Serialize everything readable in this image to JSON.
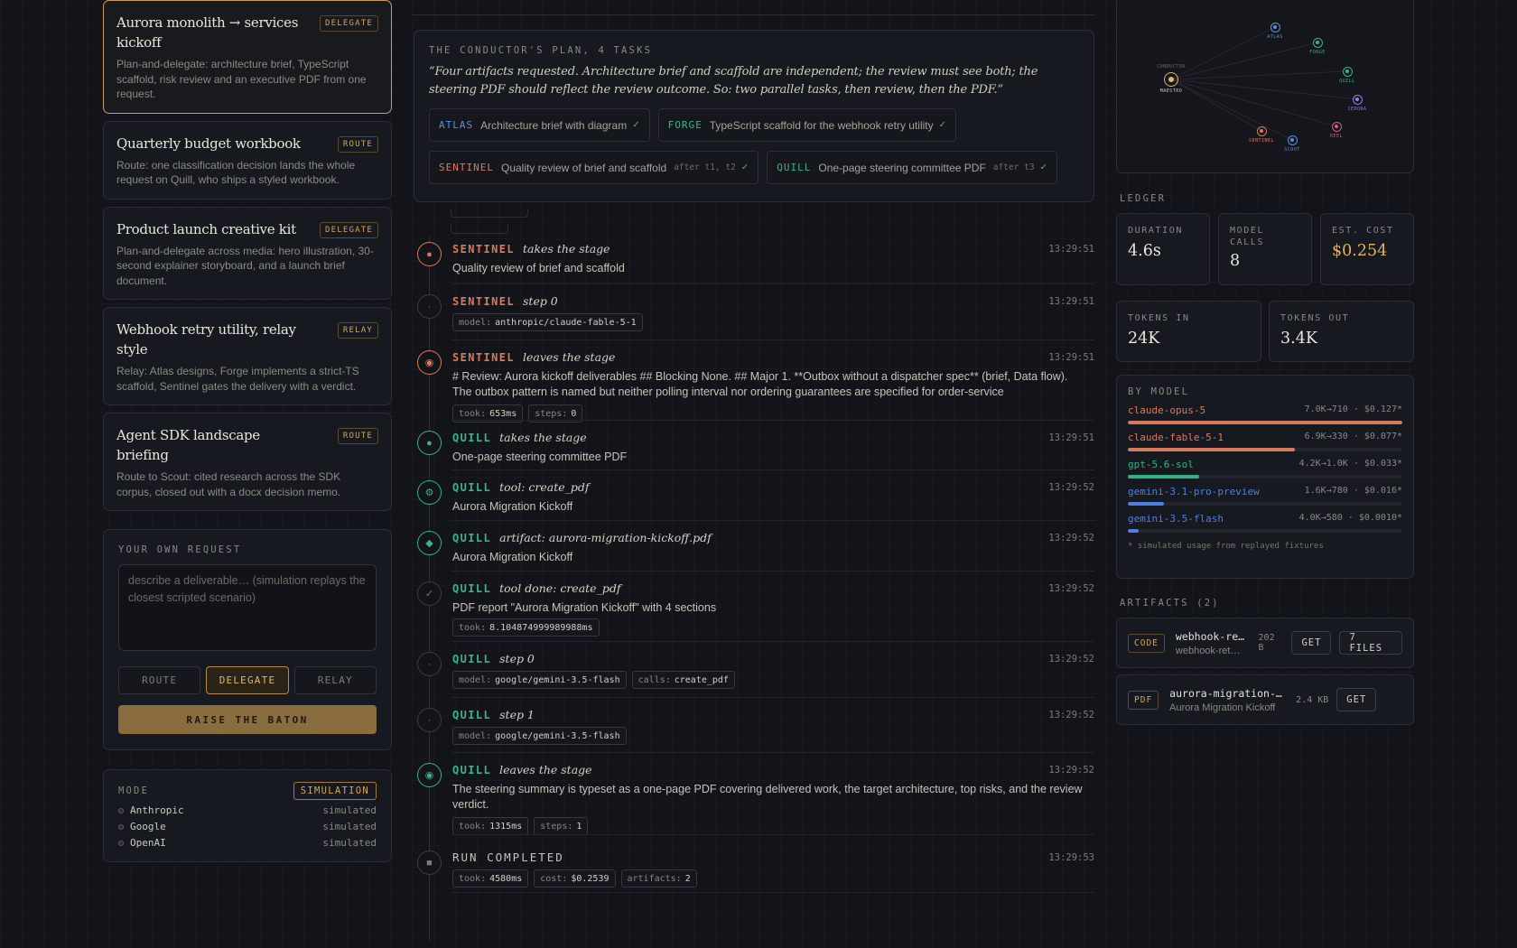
{
  "scenarios": [
    {
      "title": "Aurora monolith → services kickoff",
      "badge": "DELEGATE",
      "desc": "Plan-and-delegate: architecture brief, TypeScript scaffold, risk review and an executive PDF from one request."
    },
    {
      "title": "Quarterly budget workbook",
      "badge": "ROUTE",
      "desc": "Route: one classification decision lands the whole request on Quill, who ships a styled workbook."
    },
    {
      "title": "Product launch creative kit",
      "badge": "DELEGATE",
      "desc": "Plan-and-delegate across media: hero illustration, 30-second explainer storyboard, and a launch brief document."
    },
    {
      "title": "Webhook retry utility, relay style",
      "badge": "RELAY",
      "desc": "Relay: Atlas designs, Forge implements a strict-TS scaffold, Sentinel gates the delivery with a verdict."
    },
    {
      "title": "Agent SDK landscape briefing",
      "badge": "ROUTE",
      "desc": "Route to Scout: cited research across the SDK corpus, closed out with a docx decision memo."
    }
  ],
  "request": {
    "label": "YOUR OWN REQUEST",
    "placeholder": "describe a deliverable… (simulation replays the closest scripted scenario)",
    "modes": [
      "ROUTE",
      "DELEGATE",
      "RELAY"
    ],
    "selected_mode": "DELEGATE",
    "submit": "RAISE THE BATON"
  },
  "mode_panel": {
    "label": "MODE",
    "badge": "SIMULATION",
    "providers": [
      {
        "name": "Anthropic",
        "status": "simulated"
      },
      {
        "name": "Google",
        "status": "simulated"
      },
      {
        "name": "OpenAI",
        "status": "simulated"
      }
    ]
  },
  "plan": {
    "label": "THE CONDUCTOR'S PLAN, 4 TASKS",
    "quote": "“Four artifacts requested. Architecture brief and scaffold are independent; the review must see both; the steering PDF should reflect the review outcome. So: two parallel tasks, then review, then the PDF.”",
    "tasks": [
      {
        "agent": "ATLAS",
        "color": "#5a8fe0",
        "text": "Architecture brief with diagram",
        "after": "",
        "check": "✓"
      },
      {
        "agent": "FORGE",
        "color": "#39b38c",
        "text": "TypeScript scaffold for the webhook retry utility",
        "after": "",
        "check": "✓"
      },
      {
        "agent": "SENTINEL",
        "color": "#d77b5b",
        "text": "Quality review of brief and scaffold",
        "after": "after t1, t2",
        "check": "✓"
      },
      {
        "agent": "QUILL",
        "color": "#39b38c",
        "text": "One-page steering committee PDF",
        "after": "after t3",
        "check": "✓"
      }
    ]
  },
  "events": [
    {
      "agent": "SENTINEL",
      "action": "takes the stage",
      "time": "13:29:51",
      "body": "Quality review of brief and scaffold",
      "tags": [],
      "icon": "●"
    },
    {
      "agent": "SENTINEL",
      "action": "step 0",
      "time": "13:29:51",
      "body": "",
      "tags": [
        {
          "k": "model:",
          "v": "anthropic/claude-fable-5-1"
        }
      ],
      "icon": "·"
    },
    {
      "agent": "SENTINEL",
      "action": "leaves the stage",
      "time": "13:29:51",
      "body": "# Review: Aurora kickoff deliverables ## Blocking None. ## Major 1. **Outbox without a dispatcher spec** (brief, Data flow). The outbox pattern is named but neither polling interval nor ordering guarantees are specified for order-service",
      "tags": [
        {
          "k": "took:",
          "v": "653ms"
        },
        {
          "k": "steps:",
          "v": "0"
        }
      ],
      "icon": "◉"
    },
    {
      "agent": "QUILL",
      "action": "takes the stage",
      "time": "13:29:51",
      "body": "One-page steering committee PDF",
      "tags": [],
      "icon": "●"
    },
    {
      "agent": "QUILL",
      "action": "tool: create_pdf",
      "time": "13:29:52",
      "body": "Aurora Migration Kickoff",
      "tags": [],
      "icon": "⚙"
    },
    {
      "agent": "QUILL",
      "action": "artifact: aurora-migration-kickoff.pdf",
      "time": "13:29:52",
      "body": "Aurora Migration Kickoff",
      "tags": [],
      "icon": "◆"
    },
    {
      "agent": "QUILL",
      "action": "tool done: create_pdf",
      "time": "13:29:52",
      "body": "PDF report \"Aurora Migration Kickoff\" with 4 sections",
      "tags": [
        {
          "k": "took:",
          "v": "8.104874999989988ms"
        }
      ],
      "icon": "✓"
    },
    {
      "agent": "QUILL",
      "action": "step 0",
      "time": "13:29:52",
      "body": "",
      "tags": [
        {
          "k": "model:",
          "v": "google/gemini-3.5-flash"
        },
        {
          "k": "calls:",
          "v": "create_pdf"
        }
      ],
      "icon": "·"
    },
    {
      "agent": "QUILL",
      "action": "step 1",
      "time": "13:29:52",
      "body": "",
      "tags": [
        {
          "k": "model:",
          "v": "google/gemini-3.5-flash"
        }
      ],
      "icon": "·"
    },
    {
      "agent": "QUILL",
      "action": "leaves the stage",
      "time": "13:29:52",
      "body": "The steering summary is typeset as a one-page PDF covering delivered work, the target architecture, top risks, and the review verdict.",
      "tags": [
        {
          "k": "took:",
          "v": "1315ms"
        },
        {
          "k": "steps:",
          "v": "1"
        }
      ],
      "icon": "◉"
    }
  ],
  "run_completed": {
    "label": "RUN COMPLETED",
    "time": "13:29:53",
    "tags": [
      {
        "k": "took:",
        "v": "4580ms"
      },
      {
        "k": "cost:",
        "v": "$0.2539"
      },
      {
        "k": "artifacts:",
        "v": "2"
      }
    ],
    "icon": "■"
  },
  "graph": {
    "nodes": [
      {
        "name": "CONDUCTOR",
        "label": "MAESTRO",
        "color": "#e0b566"
      },
      {
        "name": "ATLAS",
        "label": "ATLAS",
        "color": "#5a8fe0"
      },
      {
        "name": "FORGE",
        "label": "FORGE",
        "color": "#39b38c"
      },
      {
        "name": "QUILL",
        "label": "QUILL",
        "color": "#39b38c"
      },
      {
        "name": "CERORA",
        "label": "CERORA",
        "color": "#9a7be0"
      },
      {
        "name": "REEL",
        "label": "REEL",
        "color": "#d75b7b"
      },
      {
        "name": "SENTINEL",
        "label": "SENTINEL",
        "color": "#d77b5b"
      },
      {
        "name": "SCOUT",
        "label": "SCOUT",
        "color": "#5a8fe0"
      }
    ]
  },
  "ledger": {
    "label": "LEDGER",
    "duration_label": "DURATION",
    "duration": "4.6s",
    "calls_label": "MODEL CALLS",
    "calls": "8",
    "cost_label": "EST. COST",
    "cost": "$0.254",
    "tokens_in_label": "TOKENS IN",
    "tokens_in": "24K",
    "tokens_out_label": "TOKENS OUT",
    "tokens_out": "3.4K"
  },
  "by_model": {
    "label": "BY MODEL",
    "models": [
      {
        "name": "claude-opus-5",
        "stats": "7.0K→710 · $0.127*",
        "color": "#d77b5b",
        "share": 1.0
      },
      {
        "name": "claude-fable-5-1",
        "stats": "6.9K→330 · $0.077*",
        "color": "#d77b5b",
        "share": 0.61
      },
      {
        "name": "gpt-5.6-sol",
        "stats": "4.2K→1.0K · $0.033*",
        "color": "#2fb386",
        "share": 0.26
      },
      {
        "name": "gemini-3.1-pro-preview",
        "stats": "1.6K→780 · $0.016*",
        "color": "#4e7fe0",
        "share": 0.13
      },
      {
        "name": "gemini-3.5-flash",
        "stats": "4.0K→580 · $0.0010*",
        "color": "#4e7fe0",
        "share": 0.04
      }
    ],
    "note": "* simulated usage from replayed fixtures"
  },
  "artifacts": {
    "label": "ARTIFACTS (2)",
    "items": [
      {
        "type": "CODE",
        "name": "webhook-re…",
        "sub": "webhook-ret…",
        "size": "202 B",
        "get": "GET",
        "files": "7 FILES"
      },
      {
        "type": "PDF",
        "name": "aurora-migration-kick…",
        "sub": "Aurora Migration Kickoff",
        "size": "2.4 KB",
        "get": "GET"
      }
    ]
  }
}
